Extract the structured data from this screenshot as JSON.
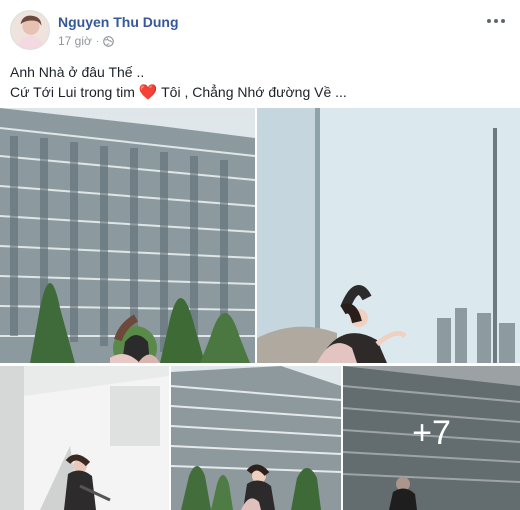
{
  "post": {
    "author": "Nguyen Thu Dung",
    "time": "17 giờ",
    "time_separator": "·",
    "privacy_icon": "globe-icon",
    "menu_icon": "more-options-icon",
    "caption": {
      "line1": "Anh Nhà ở đâu Thế ..",
      "line2_before": "Cứ Tới Lui trong tim",
      "line2_emoji": "❤️",
      "line2_after": "Tôi , Chẳng Nhớ đường Về ..."
    },
    "more_photos_label": "+7"
  },
  "colors": {
    "author_link": "#365899",
    "meta_gray": "#90949c",
    "heart": "#e0245e"
  }
}
